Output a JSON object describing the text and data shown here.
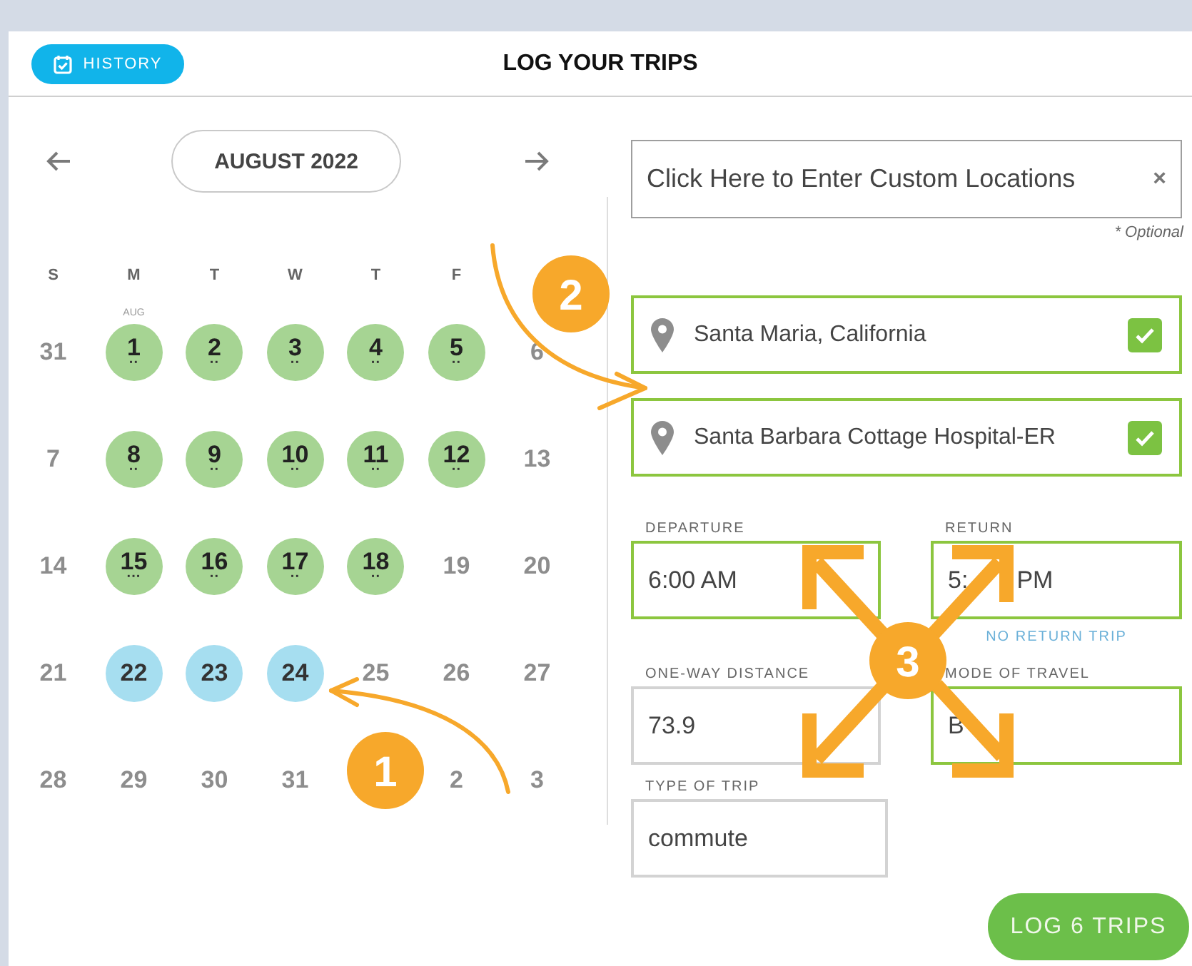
{
  "header": {
    "history_button": "HISTORY",
    "title": "LOG YOUR TRIPS"
  },
  "calendar": {
    "month": "AUGUST 2022",
    "weekdays": [
      "S",
      "M",
      "T",
      "W",
      "T",
      "F"
    ],
    "days": [
      {
        "label": "31",
        "kind": "plain"
      },
      {
        "label": "1",
        "kind": "logged",
        "tag": "AUG",
        "dots": "··"
      },
      {
        "label": "2",
        "kind": "logged",
        "dots": "··"
      },
      {
        "label": "3",
        "kind": "logged",
        "dots": "··"
      },
      {
        "label": "4",
        "kind": "logged",
        "dots": "··"
      },
      {
        "label": "5",
        "kind": "logged",
        "dots": "··"
      },
      {
        "label": "6",
        "kind": "plain"
      },
      {
        "label": "7",
        "kind": "plain"
      },
      {
        "label": "8",
        "kind": "logged",
        "dots": "··"
      },
      {
        "label": "9",
        "kind": "logged",
        "dots": "··"
      },
      {
        "label": "10",
        "kind": "logged",
        "dots": "··"
      },
      {
        "label": "11",
        "kind": "logged",
        "dots": "··"
      },
      {
        "label": "12",
        "kind": "logged",
        "dots": "··"
      },
      {
        "label": "13",
        "kind": "plain"
      },
      {
        "label": "14",
        "kind": "plain"
      },
      {
        "label": "15",
        "kind": "logged",
        "dots": "···"
      },
      {
        "label": "16",
        "kind": "logged",
        "dots": "··"
      },
      {
        "label": "17",
        "kind": "logged",
        "dots": "··"
      },
      {
        "label": "18",
        "kind": "logged",
        "dots": "··"
      },
      {
        "label": "19",
        "kind": "plain"
      },
      {
        "label": "20",
        "kind": "plain"
      },
      {
        "label": "21",
        "kind": "plain"
      },
      {
        "label": "22",
        "kind": "selected"
      },
      {
        "label": "23",
        "kind": "selected"
      },
      {
        "label": "24",
        "kind": "selected"
      },
      {
        "label": "25",
        "kind": "plain"
      },
      {
        "label": "26",
        "kind": "plain"
      },
      {
        "label": "27",
        "kind": "plain"
      },
      {
        "label": "28",
        "kind": "plain"
      },
      {
        "label": "29",
        "kind": "plain"
      },
      {
        "label": "30",
        "kind": "plain"
      },
      {
        "label": "31",
        "kind": "plain"
      },
      {
        "kind": "plain"
      },
      {
        "label": "2",
        "kind": "plain"
      },
      {
        "label": "3",
        "kind": "plain"
      }
    ]
  },
  "custom_locations": {
    "placeholder": "Click Here to Enter Custom Locations",
    "clear": "×",
    "note": "* Optional"
  },
  "locations": [
    {
      "name": "Santa Maria, California",
      "checked": true
    },
    {
      "name": "Santa Barbara Cottage Hospital-ER",
      "checked": true
    }
  ],
  "departure": {
    "label": "DEPARTURE",
    "value": "6:00 AM"
  },
  "return": {
    "label": "RETURN",
    "value": "5:",
    "value_end": "PM",
    "link": "NO RETURN TRIP"
  },
  "distance": {
    "label": "ONE-WAY DISTANCE",
    "value": "73.9"
  },
  "mode": {
    "label": "MODE OF TRAVEL",
    "value": "B"
  },
  "trip_type": {
    "label": "TYPE OF TRIP",
    "value": "commute"
  },
  "log_button": "LOG 6 TRIPS",
  "annotations": [
    {
      "label": "1"
    },
    {
      "label": "2"
    },
    {
      "label": "3"
    }
  ]
}
